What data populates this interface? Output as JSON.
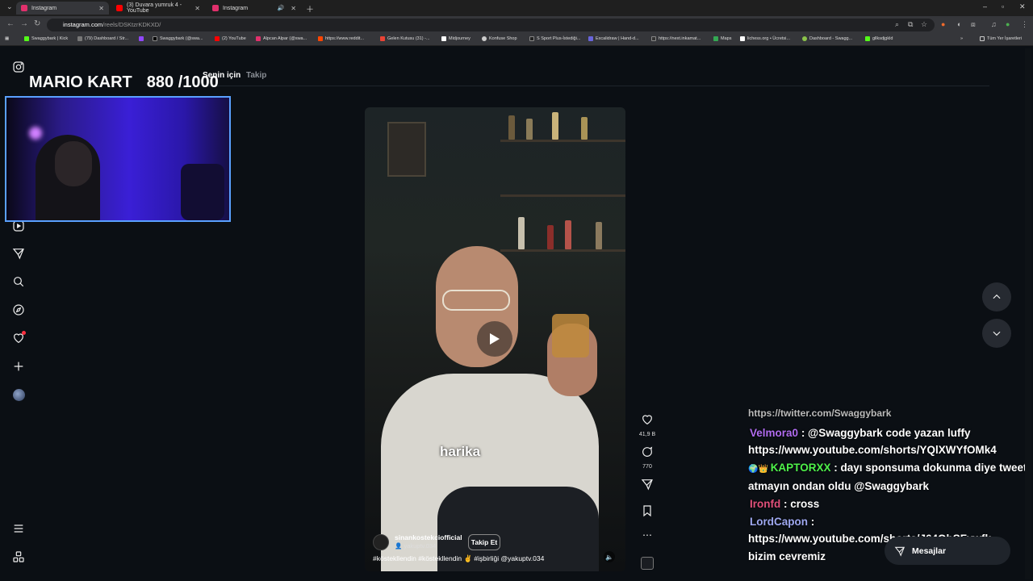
{
  "browser": {
    "tabs": [
      {
        "title": "Instagram",
        "active": true,
        "fav_color": "#e1306c"
      },
      {
        "title": "(3) Duvara yumruk 4 - YouTube",
        "active": false,
        "fav_color": "#ff0000"
      },
      {
        "title": "Instagram",
        "active": false,
        "fav_color": "#e1306c"
      }
    ],
    "url_host": "instagram.com",
    "url_path": "/reels/DSKtzrKDKXD/",
    "bookmarks": [
      "Swaggybark | Kick",
      "(79) Dashboard / Str...",
      "Swaggybark (@swa...",
      "(2) YouTube",
      "Alpcan Alpar (@swa...",
      "https://www.reddit...",
      "Gelen Kutusu (31) -...",
      "Midjourney",
      "Konfuse Shop",
      "S Sport Plus-İstediği...",
      "Excalidraw | Hand-d...",
      "https://next.inkamat...",
      "Maps",
      "lichess.org • Ücretsi...",
      "Dashboard - Swagg...",
      "gllksdjgkld"
    ],
    "all_bookmarks": "Tüm Yer İşaretleri"
  },
  "overlay": {
    "game_title": "MARIO KART",
    "score": "880 /1000"
  },
  "feed": {
    "tab_for_you": "Senin için",
    "tab_following": "Takip"
  },
  "reel": {
    "caption": "harika",
    "author": "sinankostekciofficial",
    "collab": "yakuptv.034",
    "follow_label": "Takip Et",
    "hashtags": "#köstekllendin #köstekllendin ✌ #işbirliği @yakuptv.034",
    "likes": "41,9 B",
    "comments": "770"
  },
  "chat": {
    "cut_line": "https://twitter.com/Swaggybark",
    "messages": [
      {
        "user": "Velmora0",
        "text": ": @Swaggybark code yazan luffy"
      },
      {
        "user": "",
        "text": "https://www.youtube.com/shorts/YQlXWYfOMk4"
      },
      {
        "user": "KAPTORXX",
        "text": ": dayı sponsuma dokunma diye tweet"
      },
      {
        "user": "",
        "text": "atmayın ondan oldu @Swaggybark"
      },
      {
        "user": "Ironfd",
        "text": ": cross"
      },
      {
        "user": "LordCapon",
        "text": ":"
      },
      {
        "user": "",
        "text": "https://www.youtube.com/shorts/J64OhSFywfk"
      },
      {
        "user": "",
        "text": "bizim cevremiz"
      }
    ]
  },
  "messages_button": "Mesajlar",
  "colors": {
    "accent_border": "#5aa0ff",
    "user_purple": "#b06cf0",
    "user_green": "#4ef04a",
    "user_pink": "#e0507a",
    "user_lavender": "#9ea8f0",
    "notification_dot": "#ff3040"
  }
}
